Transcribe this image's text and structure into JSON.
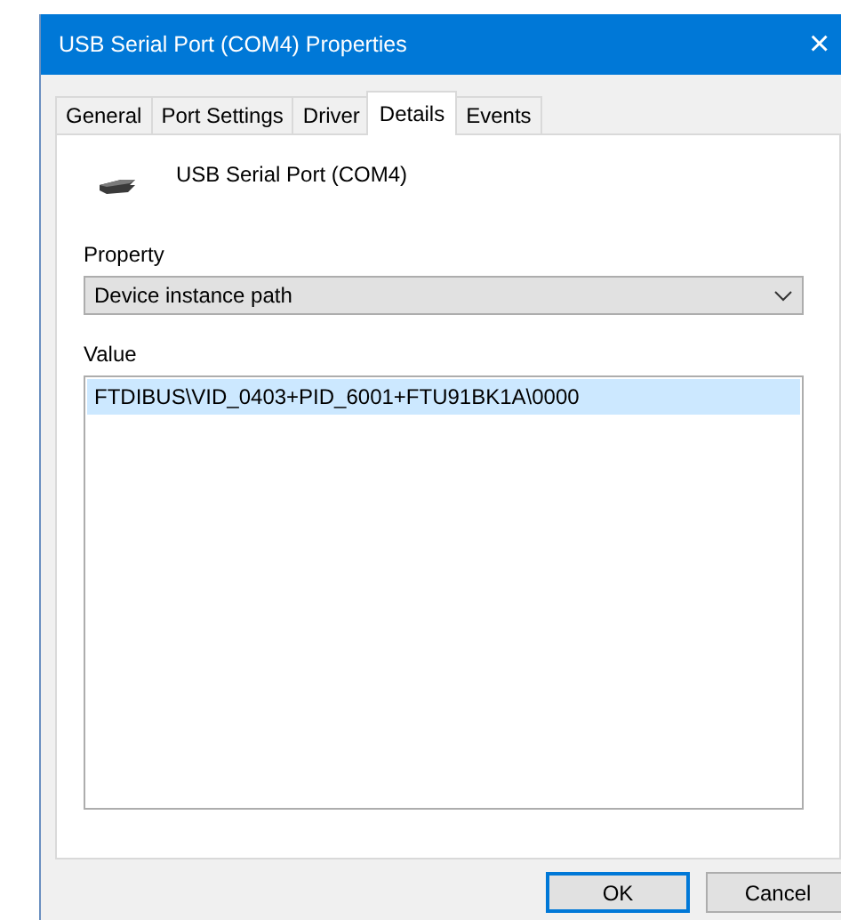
{
  "window": {
    "title": "USB Serial Port (COM4) Properties",
    "close": "×"
  },
  "tabs": [
    {
      "label": "General",
      "selected": false
    },
    {
      "label": "Port Settings",
      "selected": false
    },
    {
      "label": "Driver",
      "selected": false
    },
    {
      "label": "Details",
      "selected": true
    },
    {
      "label": "Events",
      "selected": false
    }
  ],
  "device_name": "USB Serial Port (COM4)",
  "property": {
    "label": "Property",
    "value": "Device instance path"
  },
  "value": {
    "label": "Value",
    "items": [
      {
        "text": "FTDIBUS\\VID_0403+PID_6001+FTU91BK1A\\0000",
        "selected": true
      }
    ]
  },
  "buttons": [
    {
      "label": "OK",
      "default": true
    },
    {
      "label": "Cancel",
      "default": false
    }
  ]
}
